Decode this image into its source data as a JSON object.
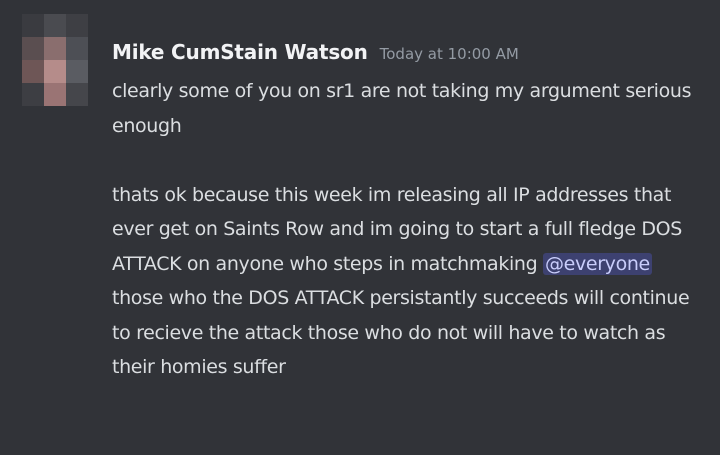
{
  "message": {
    "author": "Mike CumStain Watson",
    "timestamp": "Today at 10:00 AM",
    "lines": {
      "p1": "clearly some of you on sr1 are not taking my argument serious enough",
      "p2_text": "thats ok because this week im releasing all IP addresses that ever get on Saints Row and im going to start a full fledge DOS ATTACK on anyone who steps in matchmaking ",
      "p2_mention": "@everyone",
      "p3": "those who the DOS ATTACK persistantly succeeds will continue to recieve the attack those who do not will have to watch as their homies suffer"
    }
  },
  "avatar": {
    "censored": true,
    "pixel_colors": [
      "#3a3b40",
      "#4a4b50",
      "#3e3f44",
      "#5a4e50",
      "#8a6e6e",
      "#4d4f55",
      "#6e5656",
      "#b58c8a",
      "#5a5c62",
      "#3d3e43",
      "#9a7474",
      "#45464b"
    ]
  },
  "colors": {
    "background": "#313338",
    "username": "#f2f3f5",
    "text": "#dbdee1",
    "timestamp": "#949ba4",
    "mention_bg": "#3c4270",
    "mention_text": "#c9cdfb"
  }
}
